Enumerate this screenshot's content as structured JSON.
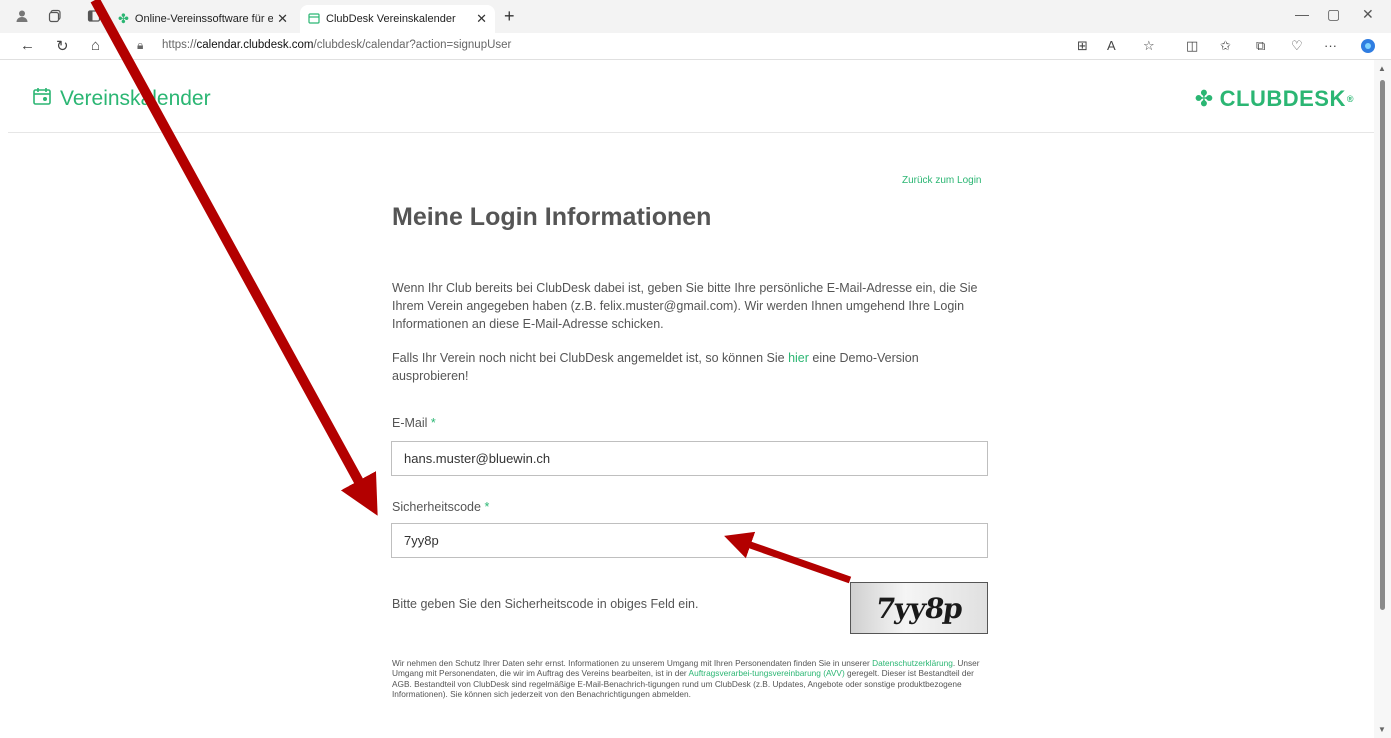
{
  "browser": {
    "tabs": [
      {
        "title": "Online-Vereinssoftware für eure"
      },
      {
        "title": "ClubDesk Vereinskalender"
      }
    ],
    "new_tab": "+",
    "url_prefix": "https://",
    "url_domain": "calendar.clubdesk.com",
    "url_path": "/clubdesk/calendar?action=signupUser"
  },
  "header": {
    "title": "Vereinskalender",
    "logo_text": "CLUBDESK",
    "logo_mark": "®"
  },
  "main": {
    "back_link": "Zurück zum Login",
    "heading": "Meine Login Informationen",
    "intro": "Wenn Ihr Club bereits bei ClubDesk dabei ist, geben Sie bitte Ihre persönliche E-Mail-Adresse ein, die Sie Ihrem Verein angegeben haben (z.B. felix.muster@gmail.com). Wir werden Ihnen umgehend Ihre Login Informationen an diese E-Mail-Adresse schicken.",
    "demo_before": "Falls Ihr Verein noch nicht bei ClubDesk angemeldet ist, so können Sie ",
    "demo_link": "hier",
    "demo_after": " eine Demo-Version ausprobieren!",
    "email_label": "E-Mail",
    "email_value": "hans.muster@bluewin.ch",
    "code_label": "Sicherheitscode",
    "code_value": "7yy8p",
    "required_mark": "*",
    "captcha_hint": "Bitte geben Sie den Sicherheitscode in obiges Feld ein.",
    "captcha_text": "7yy8p",
    "privacy_1": "Wir nehmen den Schutz Ihrer Daten sehr ernst. Informationen zu unserem Umgang mit Ihren Personendaten finden Sie in unserer ",
    "privacy_link_1": "Datenschutzerklärung",
    "privacy_2": ". Unser Umgang mit Personendaten, die wir im Auftrag des Vereins bearbeiten, ist in der ",
    "privacy_link_2": "Auftragsverarbei-tungsvereinbarung (AVV)",
    "privacy_3": " geregelt. Dieser ist Bestandteil der AGB. Bestandteil von ClubDesk sind regelmäßige E-Mail-Benachrich-tigungen rund um ClubDesk (z.B. Updates, Angebote oder sonstige produktbezogene Informationen). Sie können sich jederzeit von den Benachrichtigungen abmelden."
  },
  "colors": {
    "accent": "#2bb673",
    "annotation_arrow": "#b30000"
  }
}
